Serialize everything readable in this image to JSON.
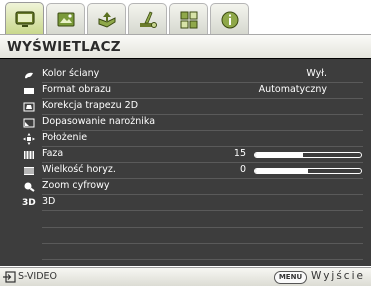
{
  "tabs": [
    {
      "icon": "display-monitor-icon",
      "active": true
    },
    {
      "icon": "picture-tools-icon",
      "active": false
    },
    {
      "icon": "source-input-icon",
      "active": false
    },
    {
      "icon": "settings-basic-icon",
      "active": false
    },
    {
      "icon": "settings-advanced-icon",
      "active": false
    },
    {
      "icon": "information-icon",
      "active": false
    }
  ],
  "header": {
    "title": "WYŚWIETLACZ"
  },
  "menu": {
    "items": [
      {
        "icon": "wall-color-icon",
        "label": "Kolor ściany",
        "value": "Wył."
      },
      {
        "icon": "aspect-ratio-icon",
        "label": "Format obrazu",
        "value": "Automatyczny"
      },
      {
        "icon": "keystone-icon",
        "label": "Korekcja trapezu 2D",
        "value": ""
      },
      {
        "icon": "corner-fit-icon",
        "label": "Dopasowanie narożnika",
        "value": ""
      },
      {
        "icon": "position-icon",
        "label": "Położenie",
        "value": ""
      },
      {
        "icon": "phase-icon",
        "label": "Faza",
        "value": "15",
        "slider": 0.45
      },
      {
        "icon": "h-size-icon",
        "label": "Wielkość horyz.",
        "value": "0",
        "slider": 0.5
      },
      {
        "icon": "digital-zoom-icon",
        "label": "Zoom cyfrowy",
        "value": ""
      },
      {
        "icon": "3d-icon",
        "label": "3D",
        "value": ""
      }
    ]
  },
  "footer": {
    "source_icon": "input-source-icon",
    "source": "S-VIDEO",
    "menu_key": "MENU",
    "exit": "Wyjście"
  },
  "colors": {
    "panel_bg": "#3d3d3d",
    "text": "#ffffff",
    "active_tab": "#c8d78a"
  }
}
